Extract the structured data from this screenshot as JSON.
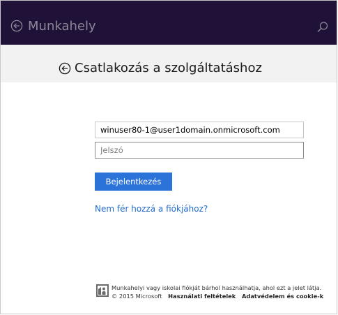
{
  "header": {
    "app_title": "Munkahely",
    "back_icon": "back-arrow-icon",
    "search_icon": "search-icon"
  },
  "subheader": {
    "title": "Csatlakozás a szolgáltatáshoz",
    "back_icon": "back-arrow-icon"
  },
  "form": {
    "email_value": "winuser80-1@user1domain.onmicrosoft.com",
    "password_placeholder": "Jelszó",
    "signin_label": "Bejelentkezés",
    "help_link": "Nem fér hozzá a fiókjához?"
  },
  "footer": {
    "logo_icon": "workplace-logo-icon",
    "line1": "Munkahelyi vagy iskolai fiókját bárhol használhatja, ahol ezt a jelet látja.",
    "copyright": "© 2015 Microsoft",
    "terms": "Használati feltételek",
    "privacy": "Adatvédelem és cookie-k"
  },
  "colors": {
    "topbar": "#1f1137",
    "accent": "#2b72d9",
    "link": "#1f6ccc"
  }
}
